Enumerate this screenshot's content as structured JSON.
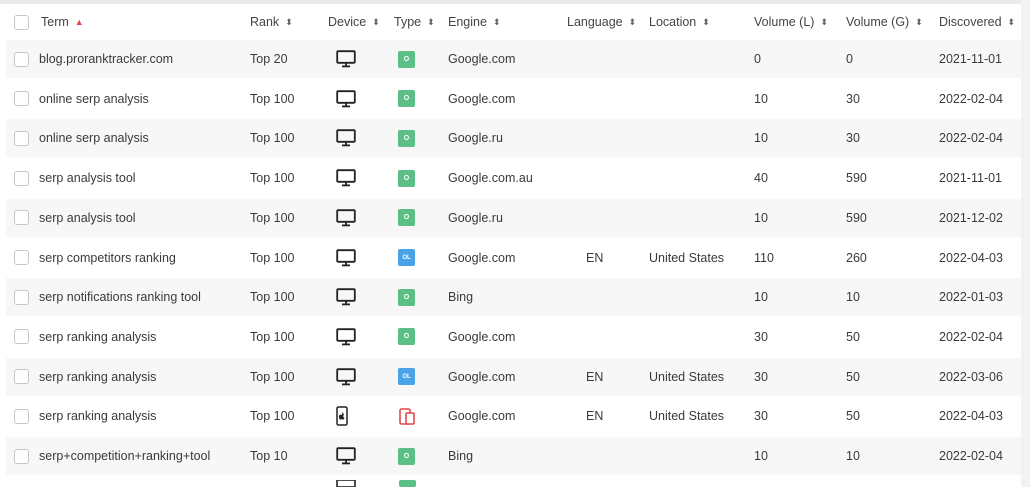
{
  "columns": {
    "term": "Term",
    "rank": "Rank",
    "device": "Device",
    "type": "Type",
    "engine": "Engine",
    "language": "Language",
    "location": "Location",
    "volume_l": "Volume (L)",
    "volume_g": "Volume (G)",
    "discovered": "Discovered"
  },
  "sort": {
    "active_column": "term",
    "direction": "asc"
  },
  "rows": [
    {
      "term": "blog.proranktracker.com",
      "rank": "Top 20",
      "device": "desktop-icon",
      "type": "O",
      "type_kind": "organic",
      "engine": "Google.com",
      "language": "",
      "location": "",
      "volume_l": "0",
      "volume_g": "0",
      "discovered": "2021-11-01"
    },
    {
      "term": "online serp analysis",
      "rank": "Top 100",
      "device": "desktop-icon",
      "type": "O",
      "type_kind": "organic",
      "engine": "Google.com",
      "language": "",
      "location": "",
      "volume_l": "10",
      "volume_g": "30",
      "discovered": "2022-02-04"
    },
    {
      "term": "online serp analysis",
      "rank": "Top 100",
      "device": "desktop-icon",
      "type": "O",
      "type_kind": "organic",
      "engine": "Google.ru",
      "language": "",
      "location": "",
      "volume_l": "10",
      "volume_g": "30",
      "discovered": "2022-02-04"
    },
    {
      "term": "serp analysis tool",
      "rank": "Top 100",
      "device": "desktop-icon",
      "type": "O",
      "type_kind": "organic",
      "engine": "Google.com.au",
      "language": "",
      "location": "",
      "volume_l": "40",
      "volume_g": "590",
      "discovered": "2021-11-01"
    },
    {
      "term": "serp analysis tool",
      "rank": "Top 100",
      "device": "desktop-icon",
      "type": "O",
      "type_kind": "organic",
      "engine": "Google.ru",
      "language": "",
      "location": "",
      "volume_l": "10",
      "volume_g": "590",
      "discovered": "2021-12-02"
    },
    {
      "term": "serp competitors ranking",
      "rank": "Top 100",
      "device": "desktop-icon",
      "type": "OL",
      "type_kind": "organic-local",
      "engine": "Google.com",
      "language": "EN",
      "location": "United States",
      "volume_l": "110",
      "volume_g": "260",
      "discovered": "2022-04-03"
    },
    {
      "term": "serp notifications ranking tool",
      "rank": "Top 100",
      "device": "desktop-icon",
      "type": "O",
      "type_kind": "organic",
      "engine": "Bing",
      "language": "",
      "location": "",
      "volume_l": "10",
      "volume_g": "10",
      "discovered": "2022-01-03"
    },
    {
      "term": "serp ranking analysis",
      "rank": "Top 100",
      "device": "desktop-icon",
      "type": "O",
      "type_kind": "organic",
      "engine": "Google.com",
      "language": "",
      "location": "",
      "volume_l": "30",
      "volume_g": "50",
      "discovered": "2022-02-04"
    },
    {
      "term": "serp ranking analysis",
      "rank": "Top 100",
      "device": "desktop-icon",
      "type": "OL",
      "type_kind": "organic-local",
      "engine": "Google.com",
      "language": "EN",
      "location": "United States",
      "volume_l": "30",
      "volume_g": "50",
      "discovered": "2022-03-06"
    },
    {
      "term": "serp ranking analysis",
      "rank": "Top 100",
      "device": "mobile-apple-icon",
      "type": "M",
      "type_kind": "mobile",
      "engine": "Google.com",
      "language": "EN",
      "location": "United States",
      "volume_l": "30",
      "volume_g": "50",
      "discovered": "2022-04-03"
    },
    {
      "term": "serp+competition+ranking+tool",
      "rank": "Top 10",
      "device": "desktop-icon",
      "type": "O",
      "type_kind": "organic",
      "engine": "Bing",
      "language": "",
      "location": "",
      "volume_l": "10",
      "volume_g": "10",
      "discovered": "2022-02-04"
    }
  ],
  "colors": {
    "organic_badge": "#5bbf86",
    "organic_local_badge": "#4aa3e6",
    "mobile_badge": "#e0474b",
    "sort_active": "#e0474b",
    "row_alt": "#f7f7f7"
  }
}
